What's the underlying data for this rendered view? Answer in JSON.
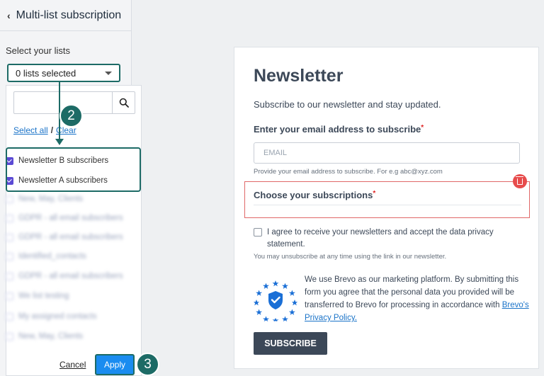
{
  "panel": {
    "title": "Multi-list subscription",
    "select_label": "Select your lists",
    "dropdown_value": "0 lists selected",
    "select_all": "Select all",
    "separator": "/",
    "clear": "Clear",
    "items": [
      {
        "label": "Newsletter B subscribers",
        "checked": true
      },
      {
        "label": "Newsletter A subscribers",
        "checked": true
      },
      {
        "label": "New, May, Clients",
        "checked": false
      },
      {
        "label": "GDPR - all email subscribers",
        "checked": false
      },
      {
        "label": "GDPR - all email subscribers",
        "checked": false
      },
      {
        "label": "Identified_contacts",
        "checked": false
      },
      {
        "label": "GDPR - all email subscribers",
        "checked": false
      },
      {
        "label": "We list testing",
        "checked": false
      },
      {
        "label": "My assigned contacts",
        "checked": false
      },
      {
        "label": "New, May, Clients",
        "checked": false
      }
    ],
    "cancel": "Cancel",
    "apply": "Apply"
  },
  "steps": {
    "two": "2",
    "three": "3"
  },
  "form": {
    "title": "Newsletter",
    "subtitle": "Subscribe to our newsletter and stay updated.",
    "email_label": "Enter your email address to subscribe",
    "required_mark": "*",
    "email_placeholder": "EMAIL",
    "email_help": "Provide your email address to subscribe. For e.g abc@xyz.com",
    "subscriptions_label": "Choose your subscriptions",
    "agree_text": "I agree to receive your newsletters and accept the data privacy statement.",
    "unsubscribe_note": "You may unsubscribe at any time using the link in our newsletter.",
    "brevo_text": "We use Brevo as our marketing platform. By submitting this form you agree that the personal data you provided will be transferred to Brevo for processing in accordance with",
    "privacy_link": "Brevo's Privacy Policy.",
    "subscribe_button": "SUBSCRIBE"
  },
  "colors": {
    "accent_teal": "#1d6b66",
    "apply_blue": "#1a8cf0",
    "checkbox_purple": "#5b4ad4",
    "button_dark": "#3c4858",
    "error_red": "#e06868",
    "brevo_blue": "#1a6fd6"
  },
  "icons": [
    "chevron-left-icon",
    "caret-down-icon",
    "search-icon",
    "trash-icon",
    "shield-check-icon"
  ]
}
